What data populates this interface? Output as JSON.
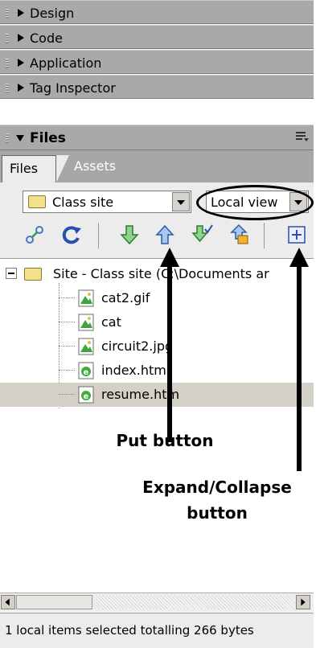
{
  "panel_groups": [
    {
      "label": "Design"
    },
    {
      "label": "Code"
    },
    {
      "label": "Application"
    },
    {
      "label": "Tag Inspector"
    }
  ],
  "files_panel": {
    "title": "Files",
    "options_icon": "options-menu-icon",
    "tabs": [
      {
        "label": "Files",
        "active": true
      },
      {
        "label": "Assets",
        "active": false
      }
    ],
    "site_select": {
      "value": "Class site",
      "icon": "folder-icon"
    },
    "view_select": {
      "value": "Local view"
    },
    "toolbar": [
      {
        "name": "connect-icon"
      },
      {
        "name": "refresh-icon"
      },
      {
        "name": "get-icon"
      },
      {
        "name": "put-icon"
      },
      {
        "name": "check-out-icon"
      },
      {
        "name": "check-in-icon"
      },
      {
        "name": "expand-collapse-icon"
      }
    ],
    "tree": {
      "root": "Site - Class site (C:\\Documents ar",
      "files": [
        {
          "name": "cat2.gif",
          "icon": "image-file-icon",
          "selected": false
        },
        {
          "name": "cat",
          "icon": "image-file-icon",
          "selected": false
        },
        {
          "name": "circuit2.jpg",
          "icon": "image-file-icon",
          "selected": false
        },
        {
          "name": "index.html",
          "icon": "html-file-icon",
          "selected": false
        },
        {
          "name": "resume.htm",
          "icon": "html-file-icon",
          "selected": true
        }
      ]
    },
    "status": "1 local items selected totalling 266 bytes"
  },
  "annotations": {
    "put_label": "Put button",
    "expand_label": "Expand/Collapse button"
  },
  "colors": {
    "header": "#a9a9a9",
    "selected_row": "#d4d0c8",
    "panel_bg": "#ececec"
  }
}
